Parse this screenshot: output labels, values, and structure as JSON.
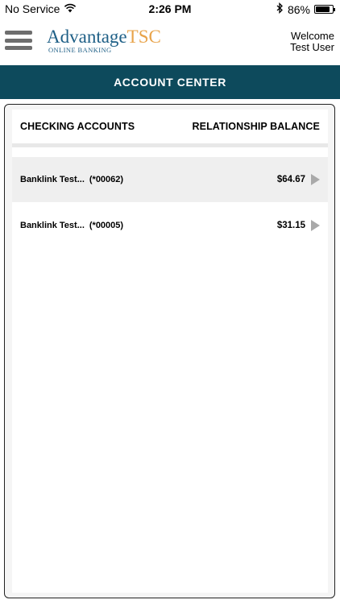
{
  "status_bar": {
    "carrier": "No Service",
    "time": "2:26 PM",
    "battery": "86%",
    "battery_level": 0.86
  },
  "header": {
    "logo_main_1": "Advantage",
    "logo_main_2": "TSC",
    "logo_sub": "ONLINE BANKING",
    "welcome_line1": "Welcome",
    "welcome_line2": "Test User"
  },
  "title": "ACCOUNT CENTER",
  "section": {
    "left_header": "CHECKING ACCOUNTS",
    "right_header": "RELATIONSHIP BALANCE"
  },
  "accounts": [
    {
      "name": "Banklink Test...",
      "number": "(*00062)",
      "balance": "$64.67"
    },
    {
      "name": "Banklink Test...",
      "number": "(*00005)",
      "balance": "$31.15"
    }
  ],
  "colors": {
    "title_bar": "#0d4a5c",
    "logo_blue": "#1e5f86",
    "logo_orange": "#e8a34a"
  }
}
